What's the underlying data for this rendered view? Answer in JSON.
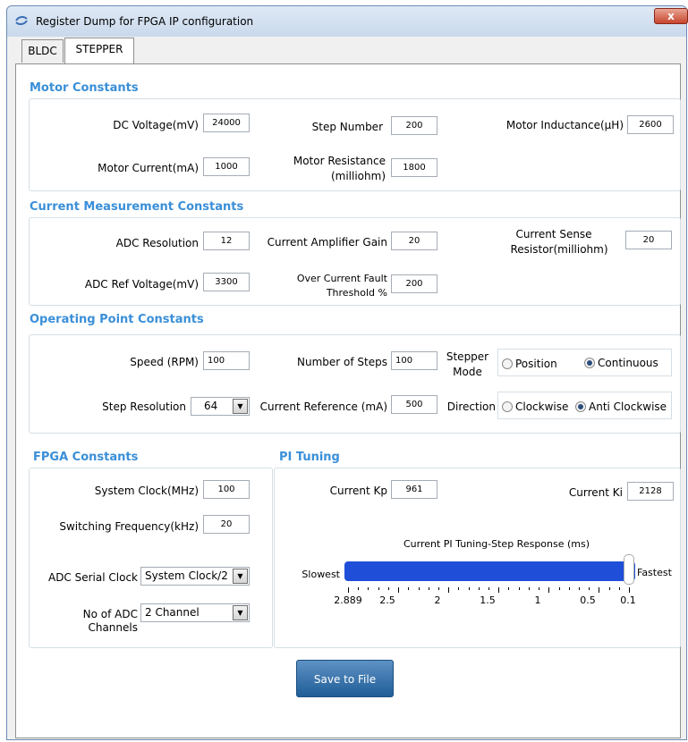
{
  "window": {
    "title": "Register Dump for FPGA IP configuration",
    "close": "x"
  },
  "tabs": [
    {
      "label": "BLDC"
    },
    {
      "label": "STEPPER"
    }
  ],
  "motor": {
    "title": "Motor Constants",
    "dc_voltage_label": "DC Voltage(mV)",
    "dc_voltage": "24000",
    "step_number_label": "Step Number",
    "step_number": "200",
    "inductance_label": "Motor Inductance(µH)",
    "inductance": "2600",
    "current_label": "Motor Current(mA)",
    "current": "1000",
    "resistance_label_1": "Motor Resistance",
    "resistance_label_2": "(milliohm)",
    "resistance": "1800"
  },
  "current_meas": {
    "title": "Current Measurement Constants",
    "adc_res_label": "ADC Resolution",
    "adc_res": "12",
    "amp_gain_label": "Current Amplifier Gain",
    "amp_gain": "20",
    "sense_label_1": "Current Sense",
    "sense_label_2": "Resistor(milliohm)",
    "sense": "20",
    "adc_ref_label": "ADC Ref Voltage(mV)",
    "adc_ref": "3300",
    "fault_label_1": "Over Current Fault",
    "fault_label_2": "Threshold %",
    "fault": "200"
  },
  "operating": {
    "title": "Operating Point Constants",
    "speed_label": "Speed (RPM)",
    "speed": "100",
    "steps_label": "Number of Steps",
    "steps": "100",
    "mode_label_1": "Stepper",
    "mode_label_2": "Mode",
    "mode_opt1": "Position",
    "mode_opt2": "Continuous",
    "step_res_label": "Step Resolution",
    "step_res": "64",
    "cur_ref_label": "Current Reference (mA)",
    "cur_ref": "500",
    "dir_label": "Direction",
    "dir_opt1": "Clockwise",
    "dir_opt2": "Anti Clockwise"
  },
  "fpga": {
    "title": "FPGA Constants",
    "sys_clock_label": "System Clock(MHz)",
    "sys_clock": "100",
    "sw_freq_label": "Switching Frequency(kHz)",
    "sw_freq": "20",
    "adc_clock_label": "ADC Serial Clock",
    "adc_clock": "System Clock/2",
    "adc_ch_label": "No of ADC Channels",
    "adc_ch": "2 Channel"
  },
  "pi": {
    "title": "PI Tuning",
    "kp_label": "Current Kp",
    "kp": "961",
    "ki_label": "Current Ki",
    "ki": "2128",
    "slider_title": "Current PI Tuning-Step Response (ms)",
    "slowest": "Slowest",
    "fastest": "Fastest",
    "slider_value_fraction": 1.0,
    "ticks": [
      "2.889",
      "2.5",
      "2",
      "1.5",
      "1",
      "0.5",
      "0.1"
    ]
  },
  "save_button": "Save to File"
}
